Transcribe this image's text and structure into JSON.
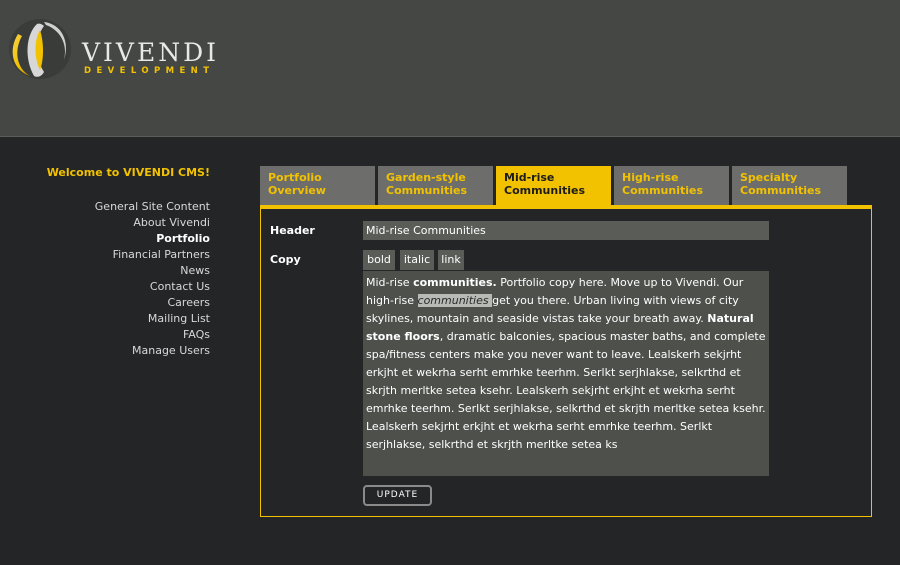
{
  "brand": {
    "name": "VIVENDI",
    "tagline": "DEVELOPMENT",
    "logo_icon": "vivendi-swirl-logo"
  },
  "colors": {
    "accent": "#f2c200",
    "background": "#232526",
    "header_bar": "#454745",
    "field_bg": "#5a5c58"
  },
  "sidebar": {
    "welcome": "Welcome to VIVENDI CMS!",
    "items": [
      {
        "label": "General Site Content"
      },
      {
        "label": "About Vivendi"
      },
      {
        "label": "Portfolio",
        "active": true
      },
      {
        "label": "Financial Partners"
      },
      {
        "label": "News"
      },
      {
        "label": "Contact Us"
      },
      {
        "label": "Careers"
      },
      {
        "label": "Mailing List"
      },
      {
        "label": "FAQs"
      },
      {
        "label": "Manage Users"
      }
    ]
  },
  "tabs": [
    {
      "line1": "Portfolio",
      "line2": "Overview"
    },
    {
      "line1": "Garden-style",
      "line2": "Communities"
    },
    {
      "line1": "Mid-rise",
      "line2": "Communities",
      "active": true
    },
    {
      "line1": "High-rise",
      "line2": "Communities"
    },
    {
      "line1": "Specialty",
      "line2": "Communities"
    }
  ],
  "form": {
    "header_label": "Header",
    "header_value": "Mid-rise Communities",
    "copy_label": "Copy",
    "format_buttons": {
      "bold": "bold",
      "italic": "italic",
      "link": "link"
    },
    "copy": {
      "p1": "Mid-rise ",
      "b1": "communities.",
      "p2": " Portfolio copy here. Move up to Vivendi. Our high-rise ",
      "i1": "communities ",
      "p3": "get you there. Urban living with views of city skylines, mountain and seaside vistas take your breath away. ",
      "b2": "Natural stone floors",
      "p4": ", dramatic balconies, spacious master baths, and complete spa/fitness centers make you never want to leave. Lealskerh sekjrht erkjht et wekrha serht emrhke teerhm. Serlkt serjhlakse, selkrthd et skrjth merltke setea ksehr. Lealskerh sekjrht erkjht et wekrha serht emrhke teerhm. Serlkt serjhlakse, selkrthd et skrjth merltke setea ksehr. Lealskerh sekjrht erkjht et wekrha serht emrhke teerhm. Serlkt serjhlakse, selkrthd et skrjth merltke setea ks"
    },
    "update_label": "UPDATE"
  }
}
